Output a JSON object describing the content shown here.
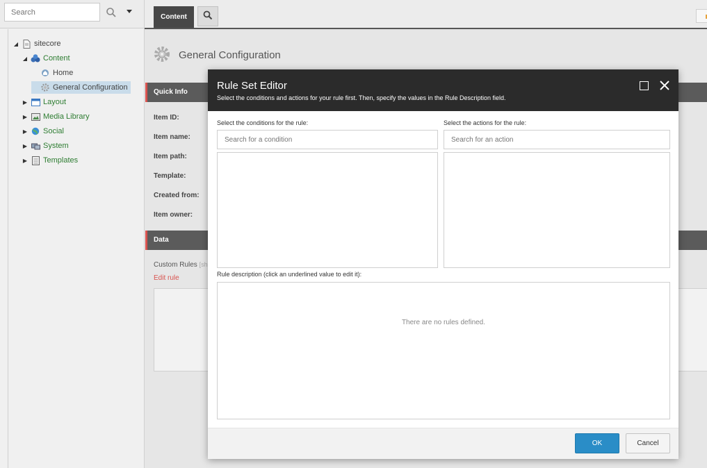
{
  "left_panel": {
    "search_placeholder": "Search",
    "tree": [
      {
        "label": "sitecore",
        "icon": "document-icon",
        "expanded": true
      },
      {
        "label": "Content",
        "icon": "content-icon",
        "expanded": true
      },
      {
        "label": "Home",
        "icon": "home-globe-icon"
      },
      {
        "label": "General Configuration",
        "icon": "gear-icon",
        "selected": true
      },
      {
        "label": "Layout",
        "icon": "layout-icon",
        "expanded": false
      },
      {
        "label": "Media Library",
        "icon": "media-library-icon",
        "expanded": false
      },
      {
        "label": "Social",
        "icon": "social-globe-icon",
        "expanded": false
      },
      {
        "label": "System",
        "icon": "system-icon",
        "expanded": false
      },
      {
        "label": "Templates",
        "icon": "templates-icon",
        "expanded": false
      }
    ]
  },
  "top_tabs": {
    "content_label": "Content"
  },
  "item": {
    "title": "General Configuration",
    "quick_info_label": "Quick Info",
    "fields": {
      "item_id": "Item ID:",
      "item_name": "Item name:",
      "item_path": "Item path:",
      "template": "Template:",
      "created_from": "Created from:",
      "item_owner": "Item owner:"
    },
    "data_section_label": "Data",
    "custom_rules_label": "Custom Rules",
    "custom_rules_hint": "[sh",
    "edit_rule_link": "Edit rule"
  },
  "modal": {
    "title": "Rule Set Editor",
    "subtitle": "Select the conditions and actions for your rule first. Then, specify the values in the Rule Description field.",
    "conditions_label": "Select the conditions for the rule:",
    "conditions_placeholder": "Search for a condition",
    "actions_label": "Select the actions for the rule:",
    "actions_placeholder": "Search for an action",
    "description_label": "Rule description (click an underlined value to edit it):",
    "empty_message": "There are no rules defined.",
    "ok_label": "OK",
    "cancel_label": "Cancel"
  },
  "colors": {
    "accent_red": "#d9534f",
    "primary_blue": "#2a8dc7",
    "modal_header": "#2b2b2b",
    "tree_link_green": "#2e7d32"
  }
}
